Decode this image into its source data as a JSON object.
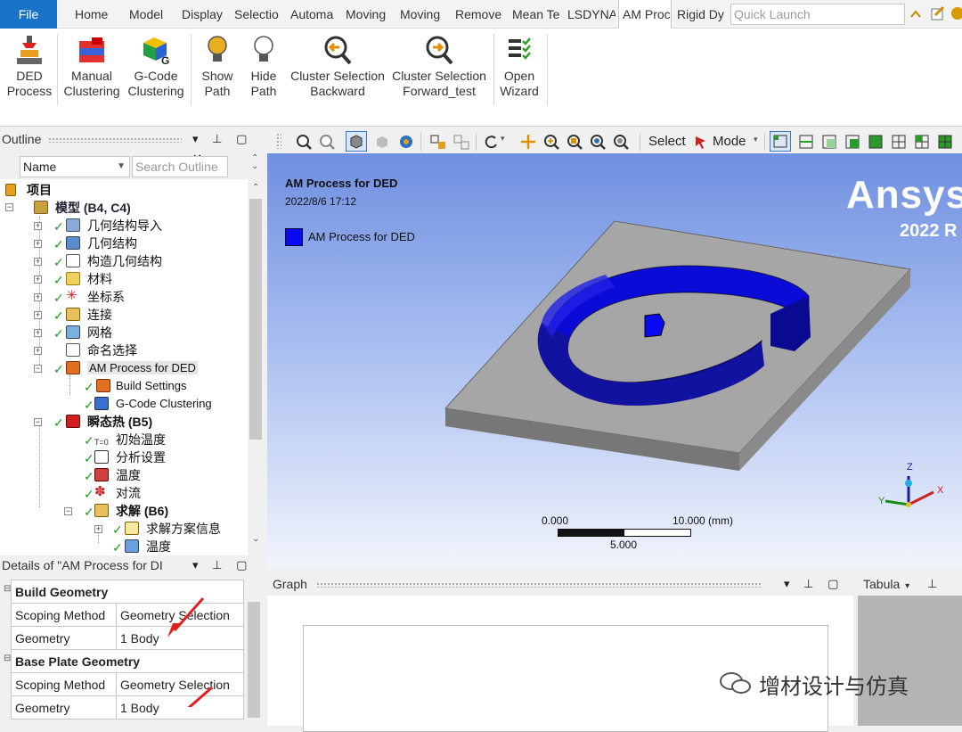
{
  "menu": {
    "file": "File",
    "tabs": [
      "Home",
      "Model",
      "Display",
      "Selectio",
      "Automa",
      "Moving",
      "Moving",
      "Remove",
      "Mean Te",
      "LSDYNA",
      "AM Proc",
      "Rigid Dy"
    ],
    "active_tab": "AM Proc",
    "quick_launch_placeholder": "Quick Launch"
  },
  "ribbon": {
    "buttons": [
      {
        "line1": "DED",
        "line2": "Process",
        "icon": "ded-process-icon"
      },
      {
        "line1": "Manual",
        "line2": "Clustering",
        "icon": "manual-clustering-icon"
      },
      {
        "line1": "G-Code",
        "line2": "Clustering",
        "icon": "gcode-clustering-icon"
      },
      {
        "line1": "Show",
        "line2": "Path",
        "icon": "show-path-bulb-icon"
      },
      {
        "line1": "Hide",
        "line2": "Path",
        "icon": "hide-path-bulb-icon"
      },
      {
        "line1": "Cluster Selection",
        "line2": "Backward",
        "icon": "cluster-backward-icon"
      },
      {
        "line1": "Cluster Selection",
        "line2": "Forward_test",
        "icon": "cluster-forward-icon"
      },
      {
        "line1": "Open",
        "line2": "Wizard",
        "icon": "wizard-icon"
      }
    ]
  },
  "outline": {
    "title": "Outline",
    "filter_label": "Name",
    "search_placeholder": "Search Outline",
    "tree": [
      {
        "label": "项目",
        "bold": true
      },
      {
        "label": "模型 (B4, C4)",
        "bold": true
      },
      {
        "label": "几何结构导入"
      },
      {
        "label": "几何结构"
      },
      {
        "label": "构造几何结构"
      },
      {
        "label": "材料"
      },
      {
        "label": "坐标系"
      },
      {
        "label": "连接"
      },
      {
        "label": "网格"
      },
      {
        "label": "命名选择"
      },
      {
        "label": "AM Process for DED"
      },
      {
        "label": "Build Settings"
      },
      {
        "label": "G-Code Clustering"
      },
      {
        "label": "瞬态热 (B5)",
        "bold": true
      },
      {
        "label": "初始温度"
      },
      {
        "label": "分析设置"
      },
      {
        "label": "温度"
      },
      {
        "label": "对流"
      },
      {
        "label": "求解 (B6)",
        "bold": true
      },
      {
        "label": "求解方案信息"
      },
      {
        "label": "温度"
      }
    ]
  },
  "toolbar": {
    "select_label": "Select",
    "mode_label": "Mode"
  },
  "viewport": {
    "title": "AM Process for DED",
    "timestamp": "2022/8/6 17:12",
    "legend_label": "AM Process for DED",
    "legend_color": "#0a0af0",
    "brand": "Ansys",
    "version": "2022 R",
    "scale": {
      "left": "0.000",
      "right": "10.000 (mm)",
      "mid": "5.000"
    },
    "axis": {
      "x": "X",
      "y": "Y",
      "z": "Z"
    }
  },
  "details": {
    "title": "Details of \"AM Process for DI",
    "rows": [
      {
        "group": "Build Geometry"
      },
      {
        "key": "Scoping Method",
        "value": "Geometry Selection"
      },
      {
        "key": "Geometry",
        "value": "1 Body"
      },
      {
        "group": "Base Plate Geometry"
      },
      {
        "key": "Scoping Method",
        "value": "Geometry Selection"
      },
      {
        "key": "Geometry",
        "value": "1 Body"
      }
    ]
  },
  "graph": {
    "title": "Graph"
  },
  "tabular": {
    "title": "Tabula"
  },
  "watermark": "增材设计与仿真"
}
